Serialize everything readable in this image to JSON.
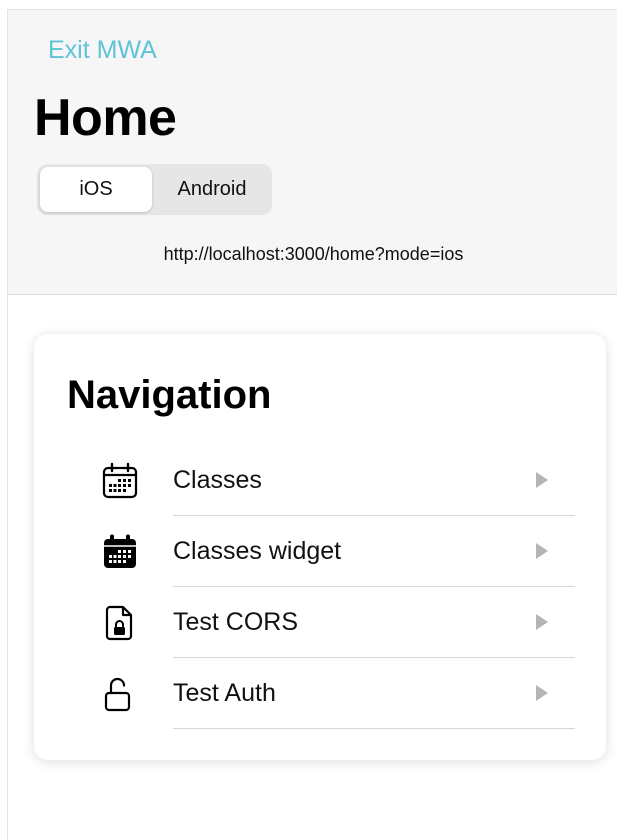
{
  "header": {
    "exit_label": "Exit MWA",
    "title": "Home",
    "segments": {
      "ios": "iOS",
      "android": "Android",
      "selected": "iOS"
    },
    "url": "http://localhost:3000/home?mode=ios",
    "link_color": "#5ec3d8"
  },
  "navigation": {
    "title": "Navigation",
    "items": [
      {
        "label": "Classes",
        "icon": "calendar-outline-icon"
      },
      {
        "label": "Classes widget",
        "icon": "calendar-filled-icon"
      },
      {
        "label": "Test CORS",
        "icon": "file-lock-icon"
      },
      {
        "label": "Test Auth",
        "icon": "unlock-icon"
      }
    ]
  }
}
